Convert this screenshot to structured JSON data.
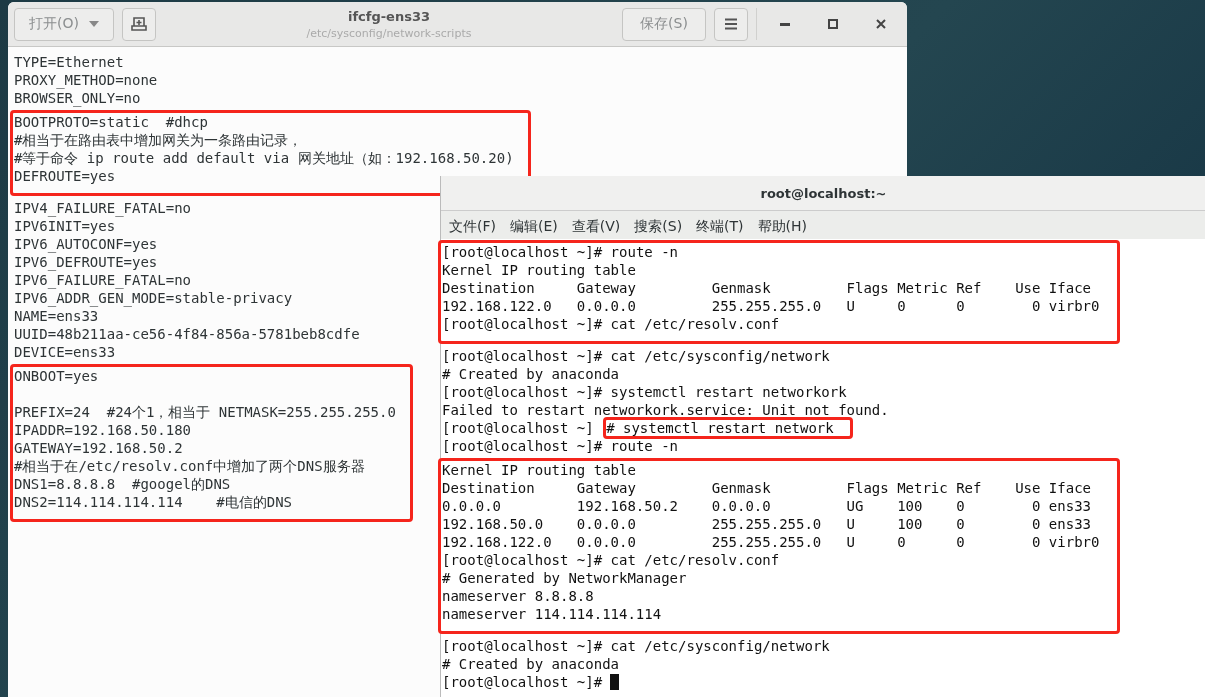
{
  "editor": {
    "title": "ifcfg-ens33",
    "subtitle": "/etc/sysconfig/network-scripts",
    "open_button": "打开(O)",
    "save_button": "保存(S)",
    "groups": [
      {
        "highlighted": false,
        "lines": [
          {
            "text": "TYPE=Ethernet",
            "space_before": false
          },
          {
            "text": "PROXY_METHOD=none",
            "space_before": false
          },
          {
            "text": "BROWSER_ONLY=no",
            "space_before": false
          }
        ]
      },
      {
        "highlighted": true,
        "lines": [
          {
            "text": "BOOTPROTO=static  #dhcp",
            "space_before": false
          },
          {
            "text": "#相当于在路由表中增加网关为一条路由记录，",
            "space_before": false
          },
          {
            "text": "#等于命令 ip route add default via 网关地址（如：192.168.50.20)",
            "space_before": false
          },
          {
            "text": "DEFROUTE=yes",
            "space_before": false
          }
        ]
      },
      {
        "highlighted": false,
        "lines": [
          {
            "text": "IPV4_FAILURE_FATAL=no",
            "space_before": false
          },
          {
            "text": "IPV6INIT=yes",
            "space_before": false
          },
          {
            "text": "IPV6_AUTOCONF=yes",
            "space_before": false
          },
          {
            "text": "IPV6_DEFROUTE=yes",
            "space_before": false
          },
          {
            "text": "IPV6_FAILURE_FATAL=no",
            "space_before": false
          },
          {
            "text": "IPV6_ADDR_GEN_MODE=stable-privacy",
            "space_before": false
          },
          {
            "text": "NAME=ens33",
            "space_before": false
          },
          {
            "text": "UUID=48b211aa-ce56-4f84-856a-5781beb8cdfe",
            "space_before": false
          },
          {
            "text": "DEVICE=ens33",
            "space_before": false
          }
        ]
      },
      {
        "highlighted": true,
        "lines": [
          {
            "text": "ONBOOT=yes",
            "space_before": false
          },
          {
            "text": "PREFIX=24  #24个1，相当于 NETMASK=255.255.255.0",
            "space_before": true
          },
          {
            "text": "IPADDR=192.168.50.180",
            "space_before": false
          },
          {
            "text": "GATEWAY=192.168.50.2",
            "space_before": false
          },
          {
            "text": "#相当于在/etc/resolv.conf中增加了两个DNS服务器",
            "space_before": false
          },
          {
            "text": "DNS1=8.8.8.8  #googel的DNS",
            "space_before": false
          },
          {
            "text": "DNS2=114.114.114.114    #电信的DNS",
            "space_before": false
          }
        ]
      }
    ]
  },
  "terminal": {
    "title": "root@localhost:~",
    "menu": [
      "文件(F)",
      "编辑(E)",
      "查看(V)",
      "搜索(S)",
      "终端(T)",
      "帮助(H)"
    ],
    "groups": [
      {
        "highlighted": true,
        "lines": [
          {
            "prompt": "[root@localhost ~]#",
            "command": "route -n",
            "command_highlighted": false
          },
          {
            "text": "Kernel IP routing table"
          },
          {
            "text": "Destination     Gateway         Genmask         Flags Metric Ref    Use Iface"
          },
          {
            "text": "192.168.122.0   0.0.0.0         255.255.255.0   U     0      0        0 virbr0"
          },
          {
            "prompt": "[root@localhost ~]#",
            "command": "cat /etc/resolv.conf",
            "command_highlighted": false
          }
        ]
      },
      {
        "highlighted": false,
        "lines": [
          {
            "prompt": "[root@localhost ~]#",
            "command": "cat /etc/sysconfig/network",
            "command_highlighted": false
          },
          {
            "text": "# Created by anaconda"
          },
          {
            "prompt": "[root@localhost ~]#",
            "command": "systemctl restart networkork",
            "command_highlighted": false
          },
          {
            "text": "Failed to restart networkork.service: Unit not found."
          },
          {
            "prompt": "[root@localhost ~]",
            "command": "# systemctl restart network",
            "command_highlighted": true
          },
          {
            "prompt": "[root@localhost ~]#",
            "command": "route -n",
            "command_highlighted": false
          }
        ]
      },
      {
        "highlighted": true,
        "lines": [
          {
            "text": "Kernel IP routing table"
          },
          {
            "text": "Destination     Gateway         Genmask         Flags Metric Ref    Use Iface"
          },
          {
            "text": "0.0.0.0         192.168.50.2    0.0.0.0         UG    100    0        0 ens33"
          },
          {
            "text": "192.168.50.0    0.0.0.0         255.255.255.0   U     100    0        0 ens33"
          },
          {
            "text": "192.168.122.0   0.0.0.0         255.255.255.0   U     0      0        0 virbr0"
          },
          {
            "prompt": "[root@localhost ~]#",
            "command": "cat /etc/resolv.conf",
            "command_highlighted": false
          },
          {
            "text": "# Generated by NetworkManager"
          },
          {
            "text": "nameserver 8.8.8.8"
          },
          {
            "text": "nameserver 114.114.114.114"
          }
        ]
      },
      {
        "highlighted": false,
        "lines": [
          {
            "prompt": "[root@localhost ~]#",
            "command": "cat /etc/sysconfig/network",
            "command_highlighted": false
          },
          {
            "text": "# Created by anaconda"
          },
          {
            "prompt": "[root@localhost ~]#",
            "cursor": true
          }
        ]
      }
    ]
  }
}
